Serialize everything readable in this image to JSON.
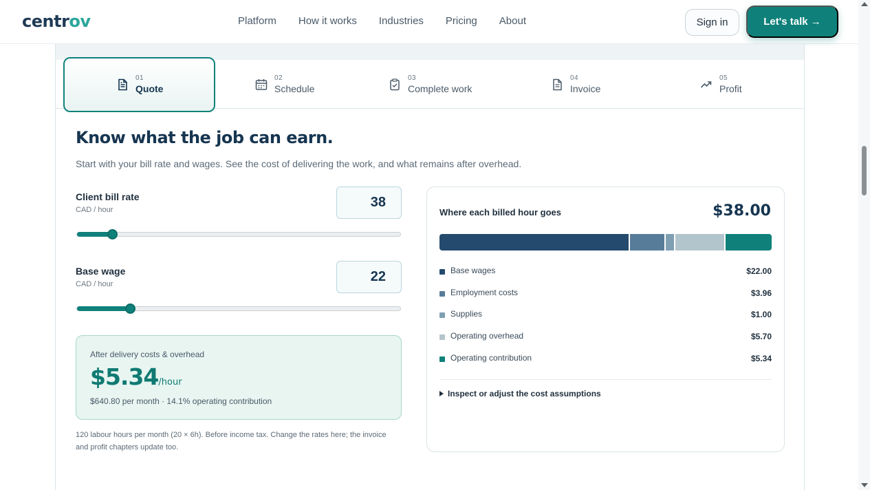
{
  "navbar": {
    "logo_main": "centr",
    "logo_accent": "ov",
    "links": [
      "Platform",
      "How it works",
      "Industries",
      "Pricing",
      "About"
    ],
    "signin_label": "Sign in",
    "cta_label": "Let's talk →"
  },
  "tabs": [
    {
      "num": "01",
      "label": "Quote",
      "icon": "document-icon",
      "active": true
    },
    {
      "num": "02",
      "label": "Schedule",
      "icon": "calendar-icon",
      "active": false
    },
    {
      "num": "03",
      "label": "Complete work",
      "icon": "clipboard-check-icon",
      "active": false
    },
    {
      "num": "04",
      "label": "Invoice",
      "icon": "invoice-icon",
      "active": false
    },
    {
      "num": "05",
      "label": "Profit",
      "icon": "trending-up-icon",
      "active": false
    }
  ],
  "content": {
    "heading": "Know what the job can earn.",
    "subtitle": "Start with your bill rate and wages. See the cost of delivering the work, and what remains after overhead."
  },
  "fields": {
    "bill_rate": {
      "label": "Client bill rate",
      "unit": "CAD / hour",
      "value": "38",
      "slider_fraction": 0.11
    },
    "base_wage": {
      "label": "Base wage",
      "unit": "CAD / hour",
      "value": "22",
      "slider_fraction": 0.165
    }
  },
  "earnings": {
    "caption": "After delivery costs & overhead",
    "value": "$5.34",
    "unit": "/hour",
    "note": "$640.80 per month · 14.1% operating contribution"
  },
  "footnote": "120 labour hours per month (20 × 6h). Before income tax. Change the rates here; the invoice and profit chapters update too.",
  "breakdown": {
    "title": "Where each billed hour goes",
    "total": "$38.00",
    "items": [
      {
        "name": "Base wages",
        "value": "$22.00",
        "amount": 22.0,
        "color": "#244a6e"
      },
      {
        "name": "Employment costs",
        "value": "$3.96",
        "amount": 3.96,
        "color": "#577c9a"
      },
      {
        "name": "Supplies",
        "value": "$1.00",
        "amount": 1.0,
        "color": "#7fa0b3"
      },
      {
        "name": "Operating overhead",
        "value": "$5.70",
        "amount": 5.7,
        "color": "#b3c5cc"
      },
      {
        "name": "Operating contribution",
        "value": "$5.34",
        "amount": 5.34,
        "color": "#0f817a"
      }
    ],
    "inspect_label": "Inspect or adjust the cost assumptions"
  },
  "colors": {
    "accent": "#0f817a",
    "navy": "#163550"
  }
}
